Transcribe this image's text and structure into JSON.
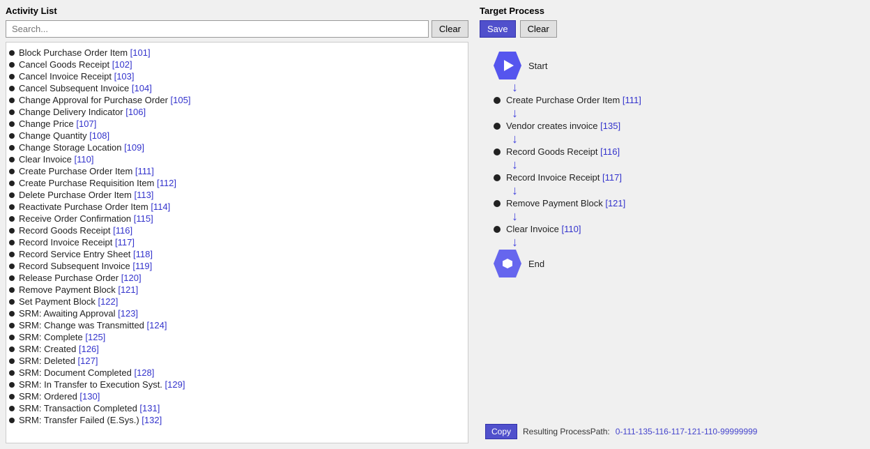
{
  "left": {
    "title": "Activity List",
    "search_placeholder": "Search...",
    "clear_label": "Clear",
    "items": [
      {
        "label": "Block Purchase Order Item ",
        "num": "[101]"
      },
      {
        "label": "Cancel Goods Receipt ",
        "num": "[102]"
      },
      {
        "label": "Cancel Invoice Receipt ",
        "num": "[103]"
      },
      {
        "label": "Cancel Subsequent Invoice ",
        "num": "[104]"
      },
      {
        "label": "Change Approval for Purchase Order ",
        "num": "[105]"
      },
      {
        "label": "Change Delivery Indicator ",
        "num": "[106]"
      },
      {
        "label": "Change Price ",
        "num": "[107]"
      },
      {
        "label": "Change Quantity ",
        "num": "[108]"
      },
      {
        "label": "Change Storage Location ",
        "num": "[109]"
      },
      {
        "label": "Clear Invoice ",
        "num": "[110]"
      },
      {
        "label": "Create Purchase Order Item ",
        "num": "[111]"
      },
      {
        "label": "Create Purchase Requisition Item ",
        "num": "[112]"
      },
      {
        "label": "Delete Purchase Order Item ",
        "num": "[113]"
      },
      {
        "label": "Reactivate Purchase Order Item ",
        "num": "[114]"
      },
      {
        "label": "Receive Order Confirmation ",
        "num": "[115]"
      },
      {
        "label": "Record Goods Receipt ",
        "num": "[116]"
      },
      {
        "label": "Record Invoice Receipt ",
        "num": "[117]"
      },
      {
        "label": "Record Service Entry Sheet ",
        "num": "[118]"
      },
      {
        "label": "Record Subsequent Invoice ",
        "num": "[119]"
      },
      {
        "label": "Release Purchase Order ",
        "num": "[120]"
      },
      {
        "label": "Remove Payment Block ",
        "num": "[121]"
      },
      {
        "label": "Set Payment Block ",
        "num": "[122]"
      },
      {
        "label": "SRM: Awaiting Approval ",
        "num": "[123]"
      },
      {
        "label": "SRM: Change was Transmitted ",
        "num": "[124]"
      },
      {
        "label": "SRM: Complete ",
        "num": "[125]"
      },
      {
        "label": "SRM: Created ",
        "num": "[126]"
      },
      {
        "label": "SRM: Deleted ",
        "num": "[127]"
      },
      {
        "label": "SRM: Document Completed ",
        "num": "[128]"
      },
      {
        "label": "SRM: In Transfer to Execution Syst. ",
        "num": "[129]"
      },
      {
        "label": "SRM: Ordered ",
        "num": "[130]"
      },
      {
        "label": "SRM: Transaction Completed ",
        "num": "[131]"
      },
      {
        "label": "SRM: Transfer Failed (E.Sys.) ",
        "num": "[132]"
      }
    ]
  },
  "right": {
    "title": "Target Process",
    "save_label": "Save",
    "clear_label": "Clear",
    "flow": [
      {
        "type": "start",
        "label": "Start"
      },
      {
        "type": "step",
        "label": "Create Purchase Order Item ",
        "num": "[111]"
      },
      {
        "type": "step",
        "label": "Vendor creates invoice ",
        "num": "[135]"
      },
      {
        "type": "step",
        "label": "Record Goods Receipt ",
        "num": "[116]"
      },
      {
        "type": "step",
        "label": "Record Invoice Receipt ",
        "num": "[117]"
      },
      {
        "type": "step",
        "label": "Remove Payment Block ",
        "num": "[121]"
      },
      {
        "type": "step",
        "label": "Clear Invoice ",
        "num": "[110]"
      },
      {
        "type": "end",
        "label": "End"
      }
    ],
    "bottom": {
      "copy_label": "Copy",
      "result_label": "Resulting ProcessPath:",
      "result_path": "0-111-135-116-117-121-110-99999999"
    }
  }
}
